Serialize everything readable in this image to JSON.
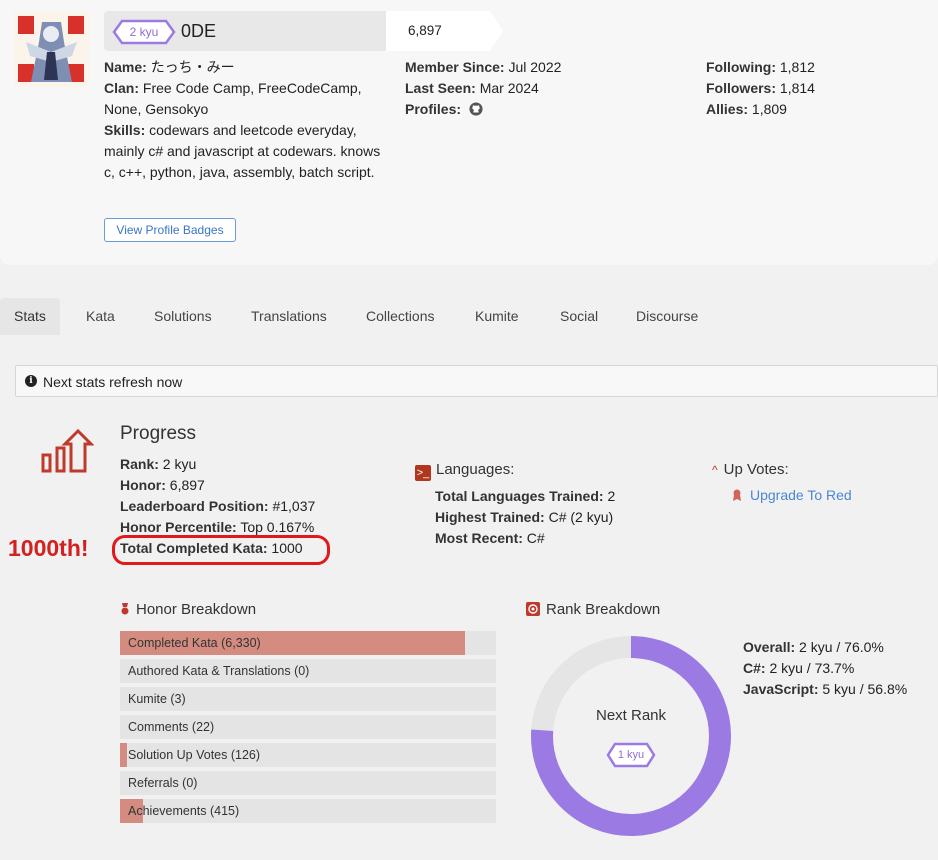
{
  "profile": {
    "rank_badge": "2 kyu",
    "username": "0DE",
    "honor": "6,897",
    "name_label": "Name:",
    "name_value": "たっち・みー",
    "clan_label": "Clan:",
    "clan_value": "Free Code Camp, FreeCodeCamp, None, Gensokyo",
    "skills_label": "Skills:",
    "skills_value": "codewars and leetcode everyday, mainly c# and javascript at codewars. knows c, c++, python, java, assembly, batch script.",
    "member_since_label": "Member Since:",
    "member_since_value": "Jul 2022",
    "last_seen_label": "Last Seen:",
    "last_seen_value": "Mar 2024",
    "profiles_label": "Profiles:",
    "profiles_icon": "github-icon",
    "following_label": "Following:",
    "following_value": "1,812",
    "followers_label": "Followers:",
    "followers_value": "1,814",
    "allies_label": "Allies:",
    "allies_value": "1,809",
    "badges_button": "View Profile Badges"
  },
  "tabs": [
    "Stats",
    "Kata",
    "Solutions",
    "Translations",
    "Collections",
    "Kumite",
    "Social",
    "Discourse"
  ],
  "refresh_text": "Next stats refresh now",
  "progress": {
    "title": "Progress",
    "rank_label": "Rank:",
    "rank_value": "2 kyu",
    "honor_label": "Honor:",
    "honor_value": "6,897",
    "leaderboard_label": "Leaderboard Position:",
    "leaderboard_value": "#1,037",
    "percentile_label": "Honor Percentile:",
    "percentile_value": "Top 0.167%",
    "completed_label": "Total Completed Kata:",
    "completed_value": "1000",
    "annotation": "1000th!"
  },
  "languages": {
    "title": "Languages:",
    "total_label": "Total Languages Trained:",
    "total_value": "2",
    "highest_label": "Highest Trained:",
    "highest_value": "C# (2 kyu)",
    "recent_label": "Most Recent:",
    "recent_value": "C#"
  },
  "upvotes": {
    "title": "Up Votes:",
    "link": "Upgrade To Red"
  },
  "honor_breakdown": {
    "title": "Honor Breakdown",
    "rows": [
      {
        "label": "Completed Kata (6,330)",
        "fraction": 0.918
      },
      {
        "label": "Authored Kata & Translations (0)",
        "fraction": 0.0
      },
      {
        "label": "Kumite (3)",
        "fraction": 0.0
      },
      {
        "label": "Comments (22)",
        "fraction": 0.0
      },
      {
        "label": "Solution Up Votes (126)",
        "fraction": 0.018
      },
      {
        "label": "Referrals (0)",
        "fraction": 0.0
      },
      {
        "label": "Achievements (415)",
        "fraction": 0.06
      }
    ]
  },
  "rank_breakdown": {
    "title": "Rank Breakdown",
    "center_label": "Next Rank",
    "next_rank": "1 kyu",
    "progress_fraction": 0.76,
    "overall_label": "Overall:",
    "overall_value": "2 kyu / 76.0%",
    "csharp_label": "C#:",
    "csharp_value": "2 kyu / 73.7%",
    "js_label": "JavaScript:",
    "js_value": "5 kyu / 56.8%"
  },
  "colors": {
    "accent_purple": "#9c7ae3",
    "honor_bar": "#d58c80",
    "annotation_red": "#e01a1a",
    "link_blue": "#4a86d6"
  }
}
